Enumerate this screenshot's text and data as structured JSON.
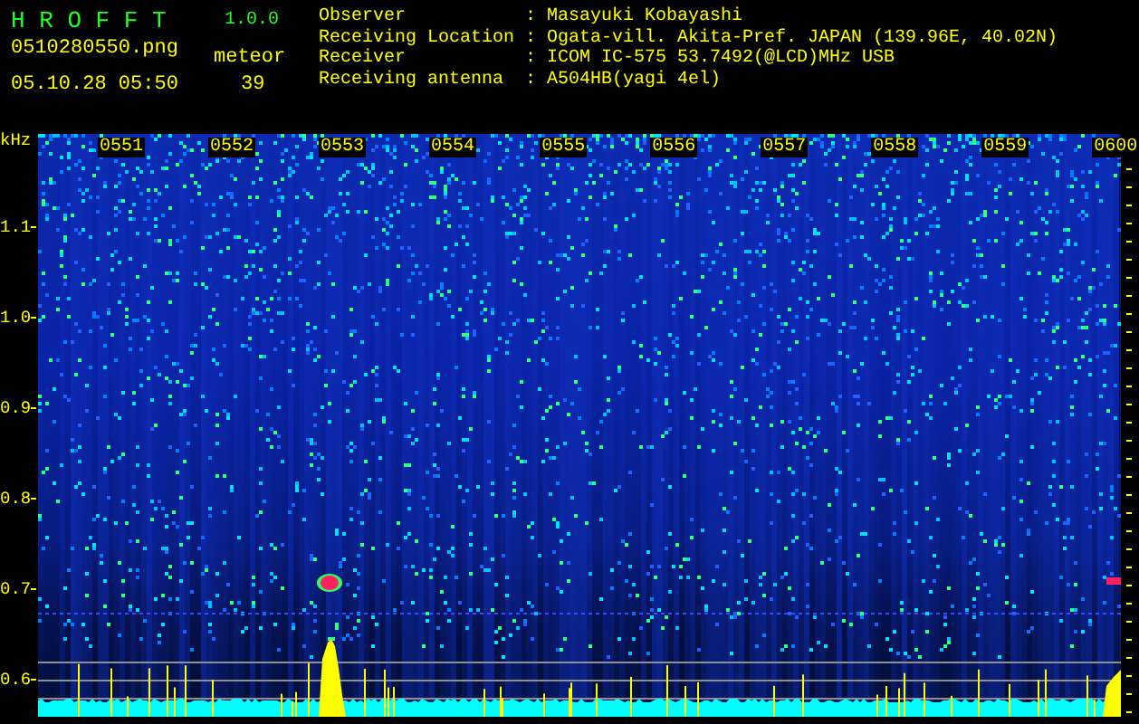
{
  "app": {
    "name": "H R O F F T",
    "version": "1.0.0"
  },
  "file": {
    "name": "0510280550.png",
    "datetime": "05.10.28 05:50"
  },
  "meteor": {
    "label": "meteor",
    "count": "39"
  },
  "station_info": [
    {
      "label": "Observer",
      "separator": ":",
      "value": "Masayuki Kobayashi"
    },
    {
      "label": "Receiving Location",
      "separator": ":",
      "value": "Ogata-vill. Akita-Pref. JAPAN (139.96E, 40.02N)"
    },
    {
      "label": "Receiver",
      "separator": ":",
      "value": "ICOM IC-575 53.7492(@LCD)MHz USB"
    },
    {
      "label": "Receiving antenna",
      "separator": ":",
      "value": "A504HB(yagi 4el)"
    }
  ],
  "spectrogram": {
    "frequency_unit": "kHz",
    "frequency_labels": [
      "1.1",
      "1.0",
      "0.9",
      "0.8",
      "0.7",
      "0.6"
    ],
    "time_labels": [
      "0551",
      "0552",
      "0553",
      "0554",
      "0555",
      "0556",
      "0557",
      "0558",
      "0559",
      "0600"
    ]
  }
}
